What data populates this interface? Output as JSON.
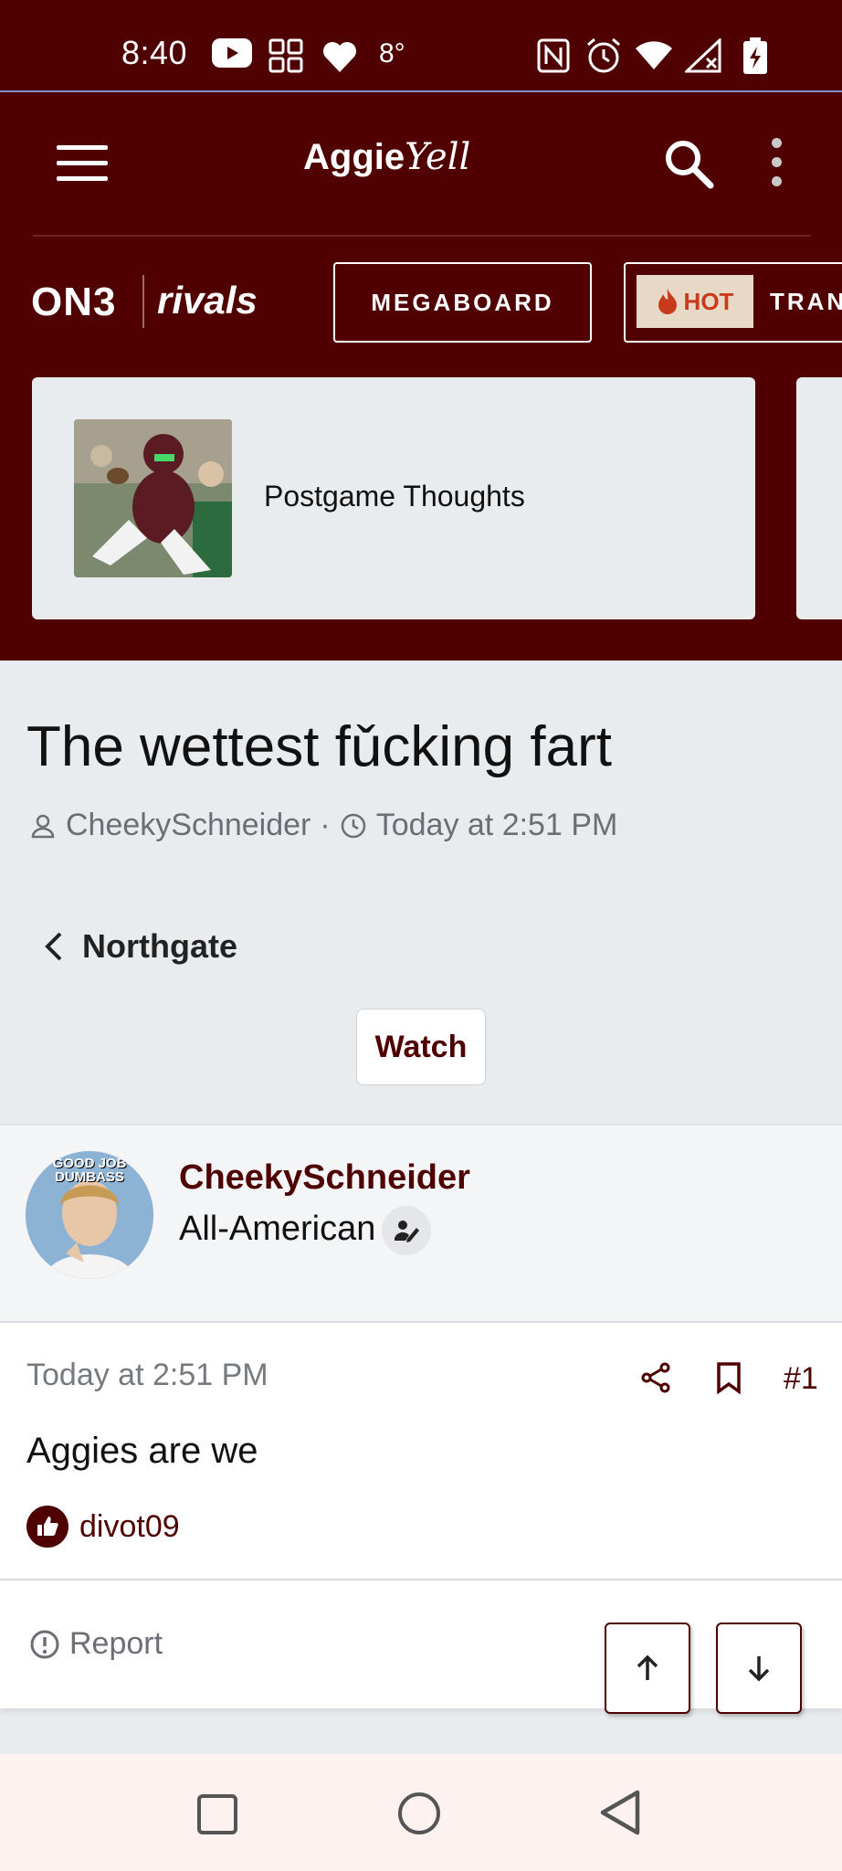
{
  "status_bar": {
    "time": "8:40",
    "temperature": "8°",
    "icons": [
      "youtube-icon",
      "grid-app-icon",
      "heart-icon",
      "nfc-icon",
      "alarm-icon",
      "wifi-icon",
      "no-signal-icon",
      "battery-charging-icon"
    ]
  },
  "header": {
    "logo_text": "Aggie",
    "logo_script": "Yell",
    "brand_on3": "ON3",
    "brand_rivals": "rivals",
    "megaboard_label": "MEGABOARD",
    "hot_badge": "HOT",
    "hot_label": "TRAN",
    "featured_card_title": "Postgame Thoughts"
  },
  "thread": {
    "title": "The wettest fǔcking fart",
    "author": "CheekySchneider",
    "separator": "·",
    "timestamp": "Today at 2:51 PM",
    "breadcrumb": "Northgate",
    "watch_label": "Watch"
  },
  "post": {
    "username": "CheekySchneider",
    "user_title": "All-American",
    "avatar_caption": "GOOD JOB DUMBASS",
    "time": "Today at 2:51 PM",
    "post_number": "#1",
    "text": "Aggies are we",
    "liked_by": "divot09",
    "report_label": "Report"
  },
  "colors": {
    "brand_maroon": "#500000",
    "hot_orange": "#c83a1b",
    "page_gray": "#e9ecef"
  }
}
